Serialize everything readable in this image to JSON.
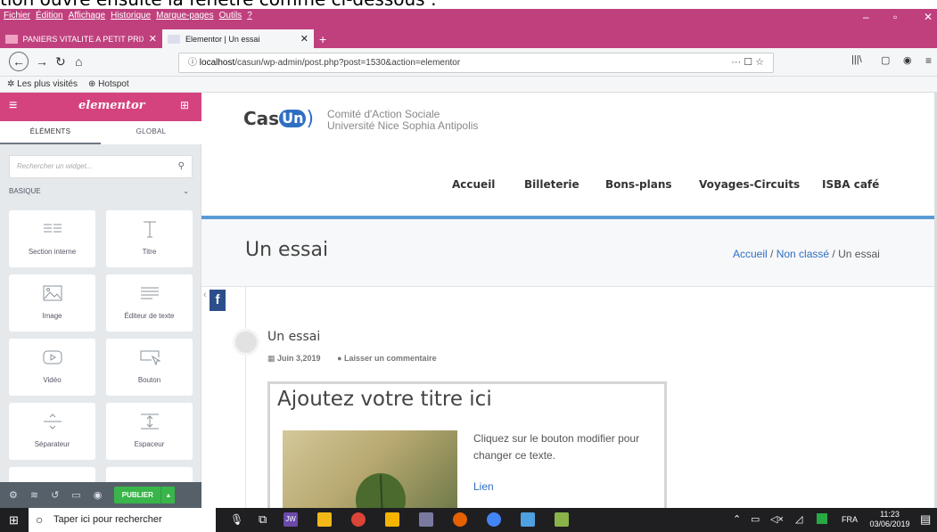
{
  "caption": "tion ouvre ensuite la fenêtre comme ci-dessous :",
  "browser": {
    "menu": [
      "Fichier",
      "Édition",
      "Affichage",
      "Historique",
      "Marque-pages",
      "Outils",
      "?"
    ],
    "tabs": [
      {
        "label": "PANIERS VITALITE A PETIT PRIX"
      },
      {
        "label": "Elementor | Un essai"
      }
    ],
    "url_prefix": "localhost",
    "url_rest": "/casun/wp-admin/post.php?post=1530&action=elementor",
    "bookmarks": [
      "Les plus visités",
      "Hotspot"
    ]
  },
  "editor": {
    "logo": "elementor",
    "tabs": [
      "ÉLÉMENTS",
      "GLOBAL"
    ],
    "search_placeholder": "Rechercher un widget...",
    "category": "BASIQUE",
    "widgets": [
      {
        "label": "Section interne",
        "icon": "columns-icon"
      },
      {
        "label": "Titre",
        "icon": "heading-icon"
      },
      {
        "label": "Image",
        "icon": "image-icon"
      },
      {
        "label": "Éditeur de texte",
        "icon": "text-editor-icon"
      },
      {
        "label": "Vidéo",
        "icon": "video-icon"
      },
      {
        "label": "Bouton",
        "icon": "button-icon"
      },
      {
        "label": "Séparateur",
        "icon": "divider-icon"
      },
      {
        "label": "Espaceur",
        "icon": "spacer-icon"
      }
    ],
    "publish_label": "PUBLIER"
  },
  "site": {
    "logo_text": "Cas",
    "logo_badge": "Un",
    "logo_line1": "Comité d'Action Sociale",
    "logo_line2": "Université Nice Sophia Antipolis",
    "nav": [
      "Accueil",
      "Billeterie",
      "Bons-plans",
      "Voyages-Circuits",
      "ISBA café"
    ],
    "page_title": "Un essai",
    "breadcrumb": [
      "Accueil",
      "Non classé",
      "Un essai"
    ],
    "post_title": "Un essai",
    "post_date": "Juin 3,2019",
    "post_comment": "Laisser un commentaire",
    "widget_heading": "Ajoutez votre titre ici",
    "widget_text": "Cliquez sur le bouton modifier pour changer ce texte.",
    "widget_link": "Lien",
    "social": "f"
  },
  "taskbar": {
    "search_placeholder": "Taper ici pour rechercher",
    "lang": "FRA",
    "time": "11:23",
    "date": "03/06/2019",
    "jw": "JW"
  },
  "colors": {
    "titlebar": "#c0407e",
    "elementor": "#d5437f",
    "publish": "#39b54a",
    "accent": "#5b9bd5"
  }
}
